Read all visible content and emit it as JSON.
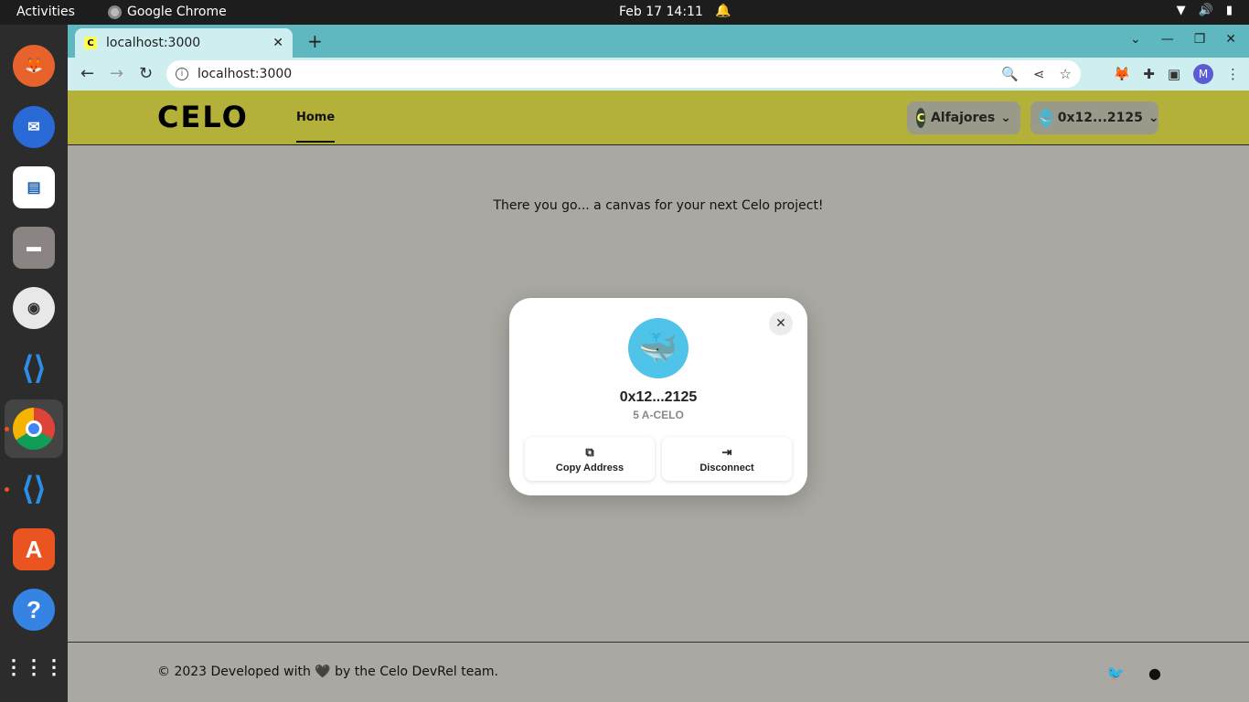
{
  "topbar": {
    "activities": "Activities",
    "app_name": "Google Chrome",
    "clock": "Feb 17  14:11"
  },
  "dock": {
    "items": [
      "firefox-icon",
      "thunderbird-icon",
      "libreoffice-writer-icon",
      "files-icon",
      "rhythmbox-icon",
      "vscode-icon",
      "chrome-icon",
      "vscode-icon",
      "app-center-icon",
      "help-icon",
      "app-grid-icon"
    ]
  },
  "browser": {
    "tab_title": "localhost:3000",
    "url": "localhost:3000",
    "profile_initial": "M"
  },
  "header": {
    "logo": "CELO",
    "nav_home": "Home",
    "network": "Alfajores",
    "account": "0x12...2125"
  },
  "main": {
    "tagline": "There you go... a canvas for your next Celo project!"
  },
  "modal": {
    "address": "0x12...2125",
    "balance": "5 A-CELO",
    "copy_label": "Copy Address",
    "disconnect_label": "Disconnect"
  },
  "footer": {
    "copyright": "© 2023 Developed with 🖤 by the Celo DevRel team."
  },
  "colors": {
    "header_bg": "#b3b13a",
    "page_bg": "#aaa8a3",
    "tabstrip_bg": "#5fb8c0"
  }
}
